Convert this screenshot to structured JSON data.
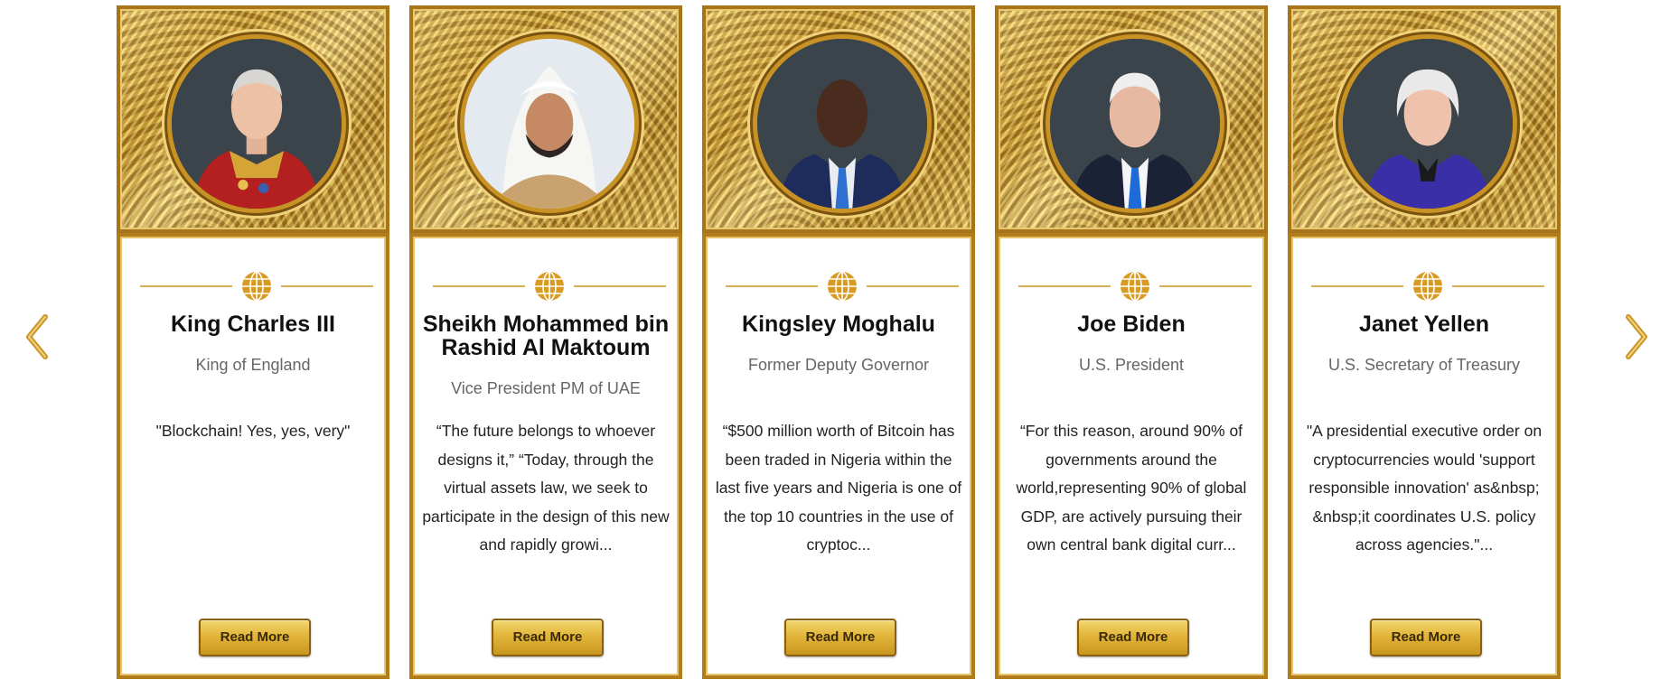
{
  "navigation": {
    "prev_icon": "chevron-left-icon",
    "next_icon": "chevron-right-icon",
    "arrow_color": "#c9962a"
  },
  "accent_color": "#c9962a",
  "cards": [
    {
      "name": "King Charles III",
      "role": "King of England",
      "quote": "\"Blockchain! Yes, yes, very\"",
      "button": "Read More",
      "portrait_icon": "portrait-king-charles"
    },
    {
      "name": "Sheikh Mohammed bin Rashid Al Maktoum",
      "role": "Vice President PM of UAE",
      "quote": "“The future belongs to whoever designs it,” “Today, through the virtual assets law, we seek to participate in the design of this new and rapidly growi...",
      "button": "Read More",
      "portrait_icon": "portrait-sheikh-mohammed"
    },
    {
      "name": "Kingsley Moghalu",
      "role": "Former Deputy Governor",
      "quote": "“$500 million worth of Bitcoin has been traded in Nigeria within the last five years and Nigeria is one of the top 10 countries in the use of cryptoc...",
      "button": "Read More",
      "portrait_icon": "portrait-kingsley-moghalu"
    },
    {
      "name": "Joe Biden",
      "role": "U.S. President",
      "quote": "“For this reason, around 90% of governments around the world,representing 90% of global GDP, are actively pursuing their own central bank digital curr...",
      "button": "Read More",
      "portrait_icon": "portrait-joe-biden"
    },
    {
      "name": "Janet Yellen",
      "role": "U.S. Secretary of Treasury",
      "quote": "\"A presidential executive order on cryptocurrencies would 'support responsible innovation' as&nbsp; &nbsp;it coordinates U.S. policy across agencies.\"...",
      "button": "Read More",
      "portrait_icon": "portrait-janet-yellen"
    }
  ]
}
